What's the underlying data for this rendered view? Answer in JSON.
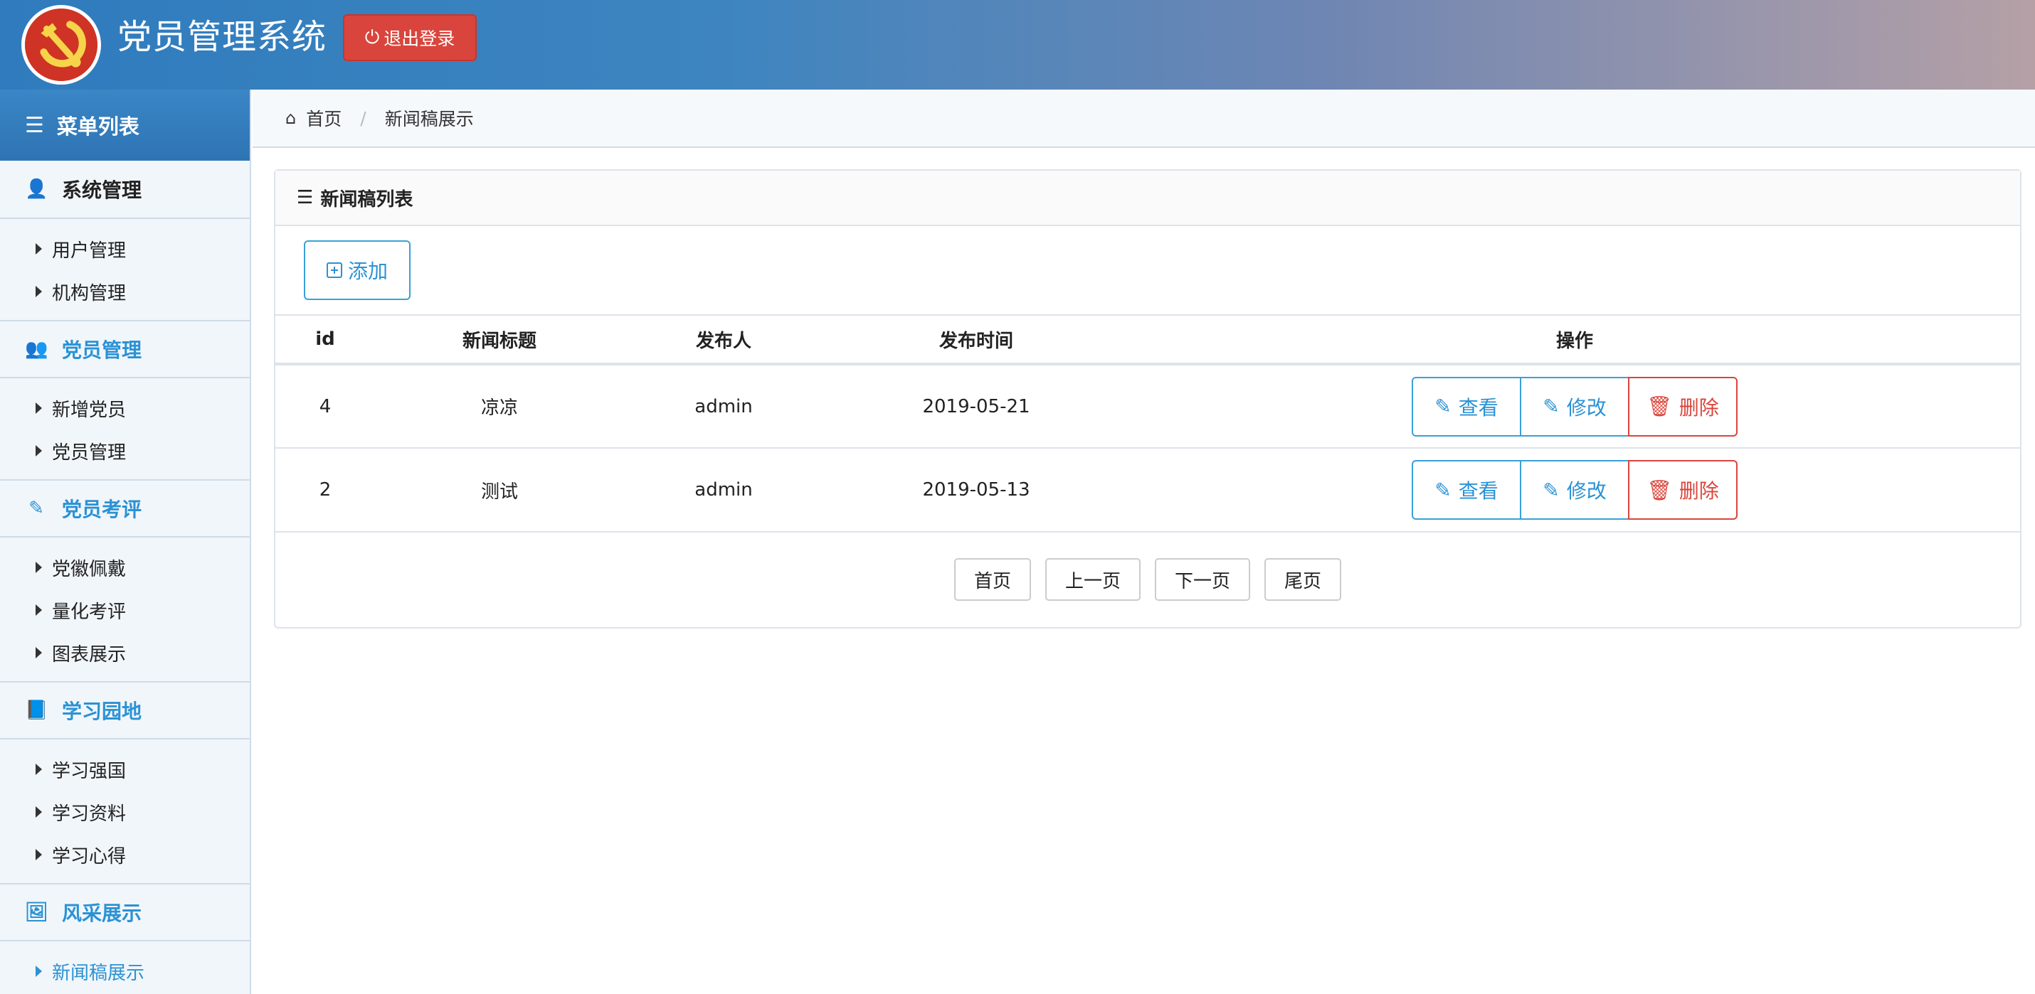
{
  "header": {
    "app_title": "党员管理系统",
    "logout_label": "退出登录",
    "brand_color": "#2f7bbd",
    "logout_color": "#d9453c"
  },
  "sidebar": {
    "menu_title": "菜单列表",
    "groups": [
      {
        "title": "系统管理",
        "icon": "user-icon",
        "items": [
          "用户管理",
          "机构管理"
        ]
      },
      {
        "title": "党员管理",
        "icon": "users-icon",
        "items": [
          "新增党员",
          "党员管理"
        ]
      },
      {
        "title": "党员考评",
        "icon": "edit-icon",
        "items": [
          "党徽佩戴",
          "量化考评",
          "图表展示"
        ]
      },
      {
        "title": "学习园地",
        "icon": "book-icon",
        "items": [
          "学习强国",
          "学习资料",
          "学习心得"
        ]
      },
      {
        "title": "风采展示",
        "icon": "image-icon",
        "items": [
          "新闻稿展示"
        ]
      }
    ],
    "active_item": "新闻稿展示"
  },
  "breadcrumb": {
    "home": "首页",
    "current": "新闻稿展示"
  },
  "panel": {
    "title": "新闻稿列表",
    "add_label": "添加",
    "columns": [
      "id",
      "新闻标题",
      "发布人",
      "发布时间",
      "操作"
    ],
    "rows": [
      {
        "id": "4",
        "title": "凉凉",
        "publisher": "admin",
        "time": "2019-05-21"
      },
      {
        "id": "2",
        "title": "测试",
        "publisher": "admin",
        "time": "2019-05-13"
      }
    ],
    "actions": {
      "view": "查看",
      "edit": "修改",
      "delete": "删除"
    },
    "pager": {
      "first": "首页",
      "prev": "上一页",
      "next": "下一页",
      "last": "尾页"
    }
  }
}
